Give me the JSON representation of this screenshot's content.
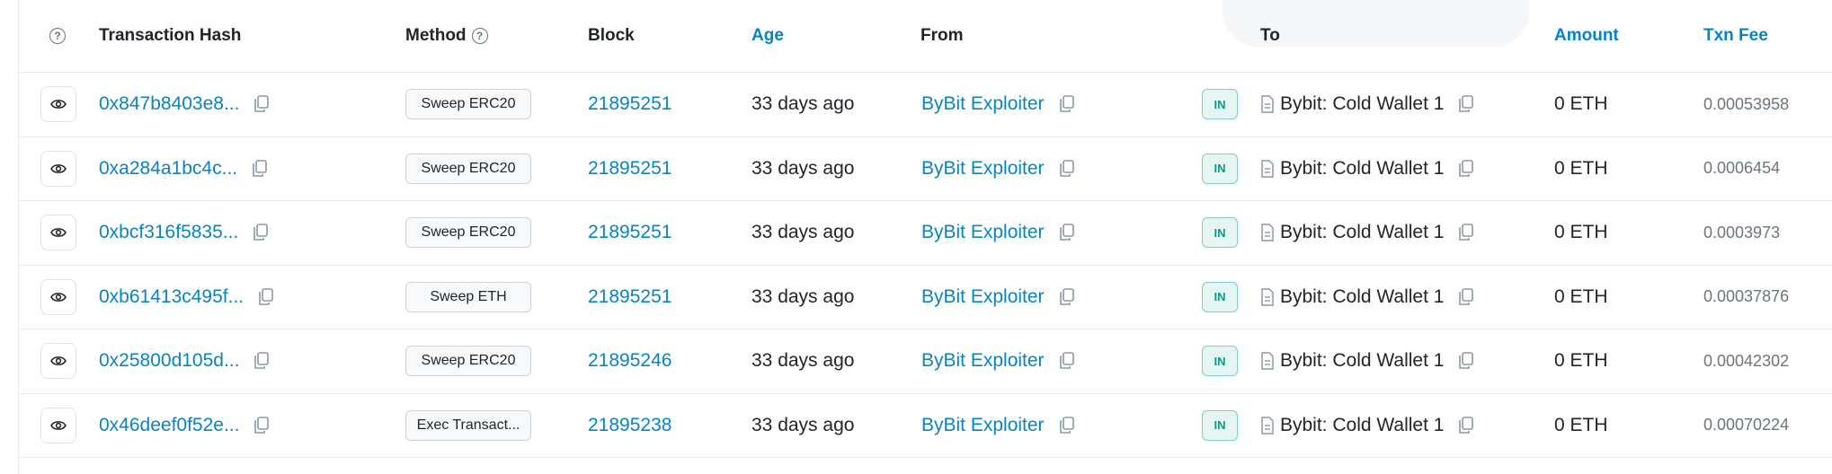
{
  "header": {
    "columns": {
      "hash": "Transaction Hash",
      "method": "Method",
      "block": "Block",
      "age": "Age",
      "from": "From",
      "to": "To",
      "amount": "Amount",
      "fee": "Txn Fee"
    },
    "help_glyph": "?"
  },
  "colors": {
    "link": "#0784c3",
    "in_badge": "#00a186",
    "muted": "#6c757d",
    "border": "#e9ecef"
  },
  "rows": [
    {
      "hash": "0x847b8403e8...",
      "method": "Sweep ERC20",
      "block": "21895251",
      "age": "33 days ago",
      "from": "ByBit Exploiter",
      "direction": "IN",
      "to": "Bybit: Cold Wallet 1",
      "amount": "0 ETH",
      "fee": "0.00053958"
    },
    {
      "hash": "0xa284a1bc4c...",
      "method": "Sweep ERC20",
      "block": "21895251",
      "age": "33 days ago",
      "from": "ByBit Exploiter",
      "direction": "IN",
      "to": "Bybit: Cold Wallet 1",
      "amount": "0 ETH",
      "fee": "0.0006454"
    },
    {
      "hash": "0xbcf316f5835...",
      "method": "Sweep ERC20",
      "block": "21895251",
      "age": "33 days ago",
      "from": "ByBit Exploiter",
      "direction": "IN",
      "to": "Bybit: Cold Wallet 1",
      "amount": "0 ETH",
      "fee": "0.0003973"
    },
    {
      "hash": "0xb61413c495f...",
      "method": "Sweep ETH",
      "block": "21895251",
      "age": "33 days ago",
      "from": "ByBit Exploiter",
      "direction": "IN",
      "to": "Bybit: Cold Wallet 1",
      "amount": "0 ETH",
      "fee": "0.00037876"
    },
    {
      "hash": "0x25800d105d...",
      "method": "Sweep ERC20",
      "block": "21895246",
      "age": "33 days ago",
      "from": "ByBit Exploiter",
      "direction": "IN",
      "to": "Bybit: Cold Wallet 1",
      "amount": "0 ETH",
      "fee": "0.00042302"
    },
    {
      "hash": "0x46deef0f52e...",
      "method": "Exec Transact...",
      "block": "21895238",
      "age": "33 days ago",
      "from": "ByBit Exploiter",
      "direction": "IN",
      "to": "Bybit: Cold Wallet 1",
      "amount": "0 ETH",
      "fee": "0.00070224"
    }
  ]
}
